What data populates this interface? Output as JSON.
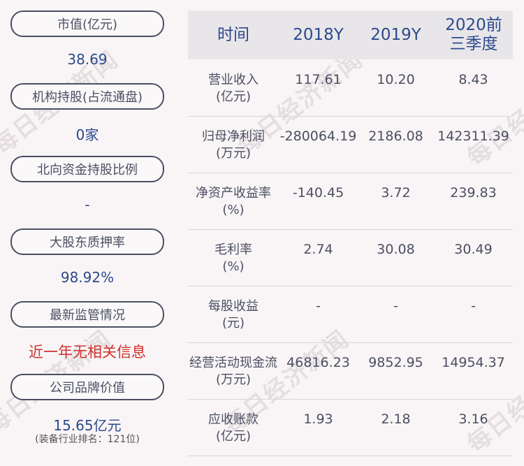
{
  "sidebar": {
    "items": [
      {
        "label": "市值(亿元)",
        "value": "38.69"
      },
      {
        "label": "机构持股(占流通盘)",
        "value": "0家"
      },
      {
        "label": "北向资金持股比例",
        "value": "-"
      },
      {
        "label": "大股东质押率",
        "value": "98.92%"
      },
      {
        "label": "最新监管情况",
        "value": "近一年无相关信息"
      },
      {
        "label": "公司品牌价值",
        "value": "15.65亿元",
        "note": "(装备行业排名：121位)"
      }
    ]
  },
  "table": {
    "headers": [
      "时间",
      "2018Y",
      "2019Y",
      "2020前三季度"
    ],
    "rows": [
      {
        "label": "营业收入\n(亿元)",
        "cells": [
          "117.61",
          "10.20",
          "8.43"
        ]
      },
      {
        "label": "归母净利润\n(万元)",
        "cells": [
          "-280064.19",
          "2186.08",
          "142311.39"
        ]
      },
      {
        "label": "净资产收益率\n(%)",
        "cells": [
          "-140.45",
          "3.72",
          "239.83"
        ]
      },
      {
        "label": "毛利率\n(%)",
        "cells": [
          "2.74",
          "30.08",
          "30.49"
        ]
      },
      {
        "label": "每股收益\n(元)",
        "cells": [
          "-",
          "-",
          "-"
        ]
      },
      {
        "label": "经营活动现金流\n(万元)",
        "cells": [
          "46816.23",
          "9852.95",
          "14954.37"
        ]
      },
      {
        "label": "应收账款\n(亿元)",
        "cells": [
          "1.93",
          "2.18",
          "3.16"
        ]
      }
    ]
  },
  "watermark": "每日经济新闻",
  "colors": {
    "accent": "#2c4a8c",
    "pill_border": "#4a4f63",
    "alert": "#d0312d"
  }
}
